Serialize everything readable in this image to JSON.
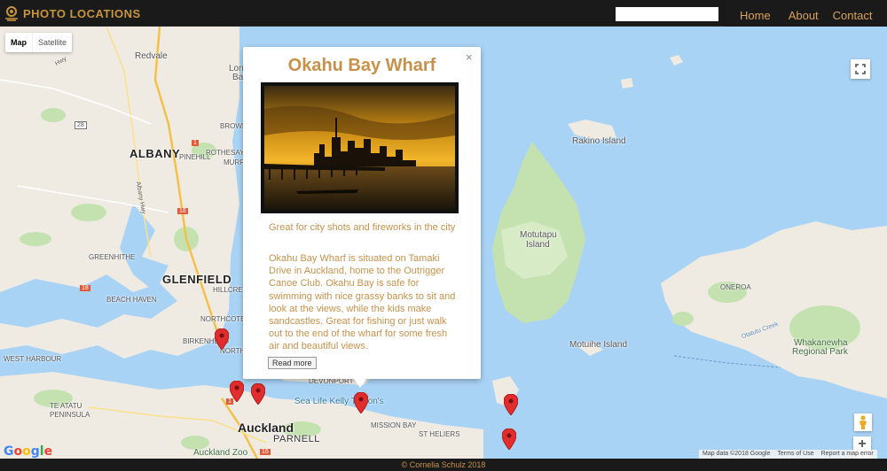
{
  "brand": {
    "name": "PHOTO LOCATIONS",
    "icon": "camera-pin-icon",
    "color": "#c8953f"
  },
  "search": {
    "placeholder": "",
    "value": ""
  },
  "nav": [
    {
      "label": "Home"
    },
    {
      "label": "About"
    },
    {
      "label": "Contact"
    }
  ],
  "map": {
    "type_control": {
      "map": "Map",
      "satellite": "Satellite",
      "selected": "Map"
    },
    "labels": {
      "redvale": "Redvale",
      "long_bay": "Long",
      "long_bay2": "Bay",
      "albany": "ALBANY",
      "pinehill": "PINEHILL",
      "rothesay": "ROTHESAY BAY",
      "murrays": "MURRA",
      "browns": "BROWNS",
      "rakino": "Rakino Island",
      "motutapu": "Motutapu",
      "motutapu2": "Island",
      "glenfield": "GLENFIELD",
      "beach_haven": "BEACH HAVEN",
      "greenhithe": "GREENHITHE",
      "hillcrest": "HILLCREST",
      "northcote": "NORTHCOTE",
      "birkenhead": "BIRKENHEAD",
      "northcote_pt": "NORTHCOTE",
      "west_harbour": "WEST HARBOUR",
      "te_atatu": "TE ATATU",
      "peninsula": "PENINSULA",
      "devonport": "DEVONPORT",
      "sea_life": "Sea Life Kelly Tarlton's",
      "auckland": "Auckland",
      "parnell": "PARNELL",
      "mission_bay": "MISSION BAY",
      "st_heliers": "ST HELIERS",
      "auckland_zoo": "Auckland Zoo",
      "motuihe": "Motuihe Island",
      "oneroa": "ONEROA",
      "whakanewha": "Whakanewha",
      "whakanewha2": "Regional Park",
      "otatutu": "Otatutu Creek",
      "albany_hwy": "Albany Hwy",
      "hwy": "Hwy"
    },
    "shields": [
      "28",
      "18",
      "1",
      "18",
      "16",
      "1"
    ],
    "attribution": {
      "data": "Map data ©2018 Google",
      "terms": "Terms of Use",
      "report": "Report a map error"
    },
    "google_logo": "Google",
    "zoom_in": "+",
    "zoom_out": "−",
    "water_color": "#a9d3f5",
    "land_color": "#efebe3",
    "park_color": "#c4e2b0"
  },
  "infowindow": {
    "title": "Okahu Bay Wharf",
    "close": "×",
    "subtitle": "Great for city shots and fireworks in the city",
    "description": "Okahu Bay Wharf is situated on Tamaki Drive in Auckland, home to the Outrigger Canoe Club. Okahu Bay is safe for swimming with nice grassy banks to sit and look at the views, while the kids make sandcastles. Great for fishing or just walk out to the end of the wharf for some fresh air and beautiful views.",
    "read_more": "Read more",
    "accent": "#c8914a"
  },
  "footer": {
    "text": "© Cornelia Schulz 2018"
  }
}
